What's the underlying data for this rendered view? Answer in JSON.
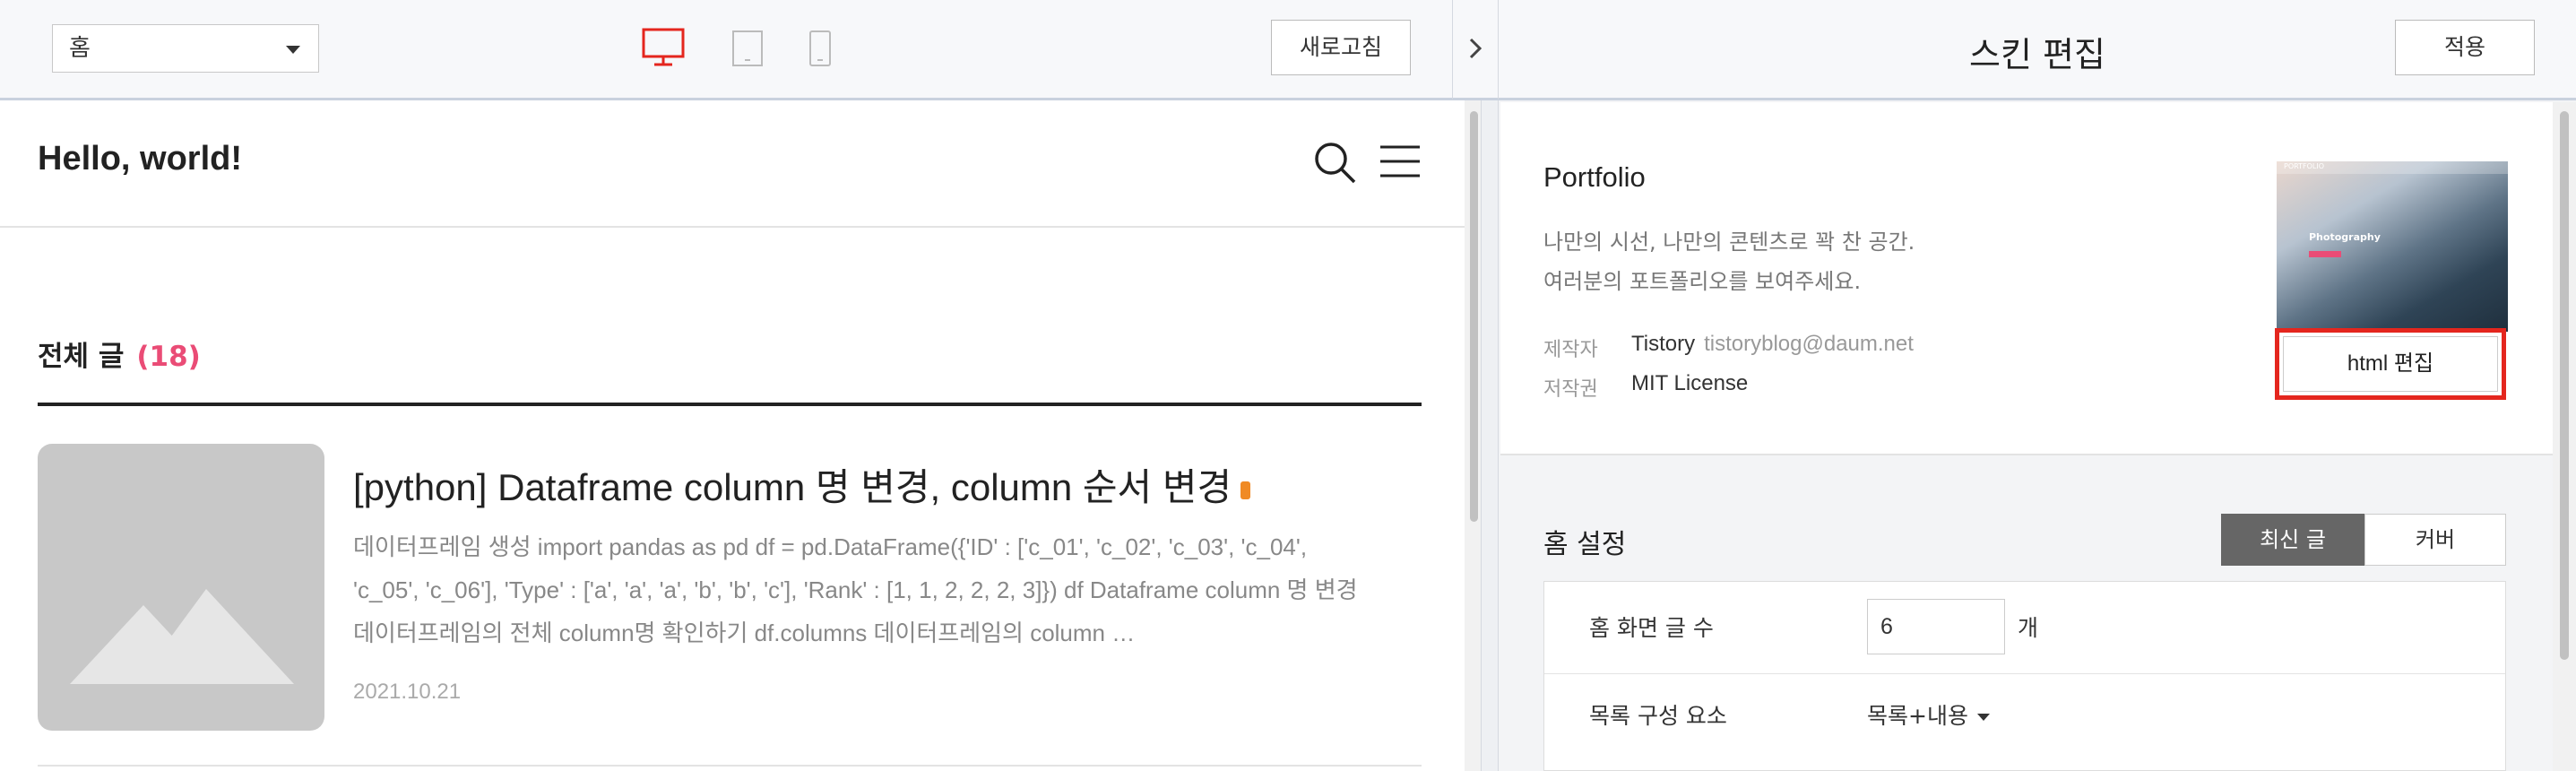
{
  "toolbar": {
    "page_select": "홈",
    "devices": [
      "desktop-icon",
      "tablet-icon",
      "mobile-icon"
    ],
    "refresh_label": "새로고침",
    "active_color": "#e4261e"
  },
  "preview": {
    "blog_title": "Hello, world!",
    "section": {
      "heading": "전체 글",
      "count": "(18)"
    },
    "post": {
      "title": "[python] Dataframe column 명 변경, column 순서 변경",
      "excerpt": "데이터프레임 생성 import pandas as pd df = pd.DataFrame({'ID' : ['c_01', 'c_02', 'c_03', 'c_04', 'c_05', 'c_06'], 'Type' : ['a', 'a', 'a', 'b', 'b', 'c'], 'Rank' : [1, 1, 2, 2, 2, 3]}) df Dataframe column 명 변경 데이터프레임의 전체 column명 확인하기 df.columns 데이터프레임의 column …",
      "date": "2021.10.21"
    }
  },
  "editor": {
    "title": "스킨 편집",
    "apply_label": "적용",
    "skin": {
      "name": "Portfolio",
      "desc_line1": "나만의 시선, 나만의 콘텐츠로 꽉 찬 공간.",
      "desc_line2": "여러분의 포트폴리오를 보여주세요.",
      "maker_label": "제작자",
      "maker": "Tistory",
      "maker_email": "tistoryblog@daum.net",
      "license_label": "저작권",
      "license": "MIT License",
      "thumb_label": "Photography",
      "html_edit_label": "html 편집"
    },
    "home_settings": {
      "title": "홈 설정",
      "tab_latest": "최신 글",
      "tab_cover": "커버",
      "count_label": "홈 화면 글 수",
      "count_value": "6",
      "count_unit": "개",
      "list_label": "목록 구성 요소",
      "list_value": "목록+내용"
    },
    "highlight_color": "#e4261e",
    "accent_color": "#ea4c76"
  }
}
